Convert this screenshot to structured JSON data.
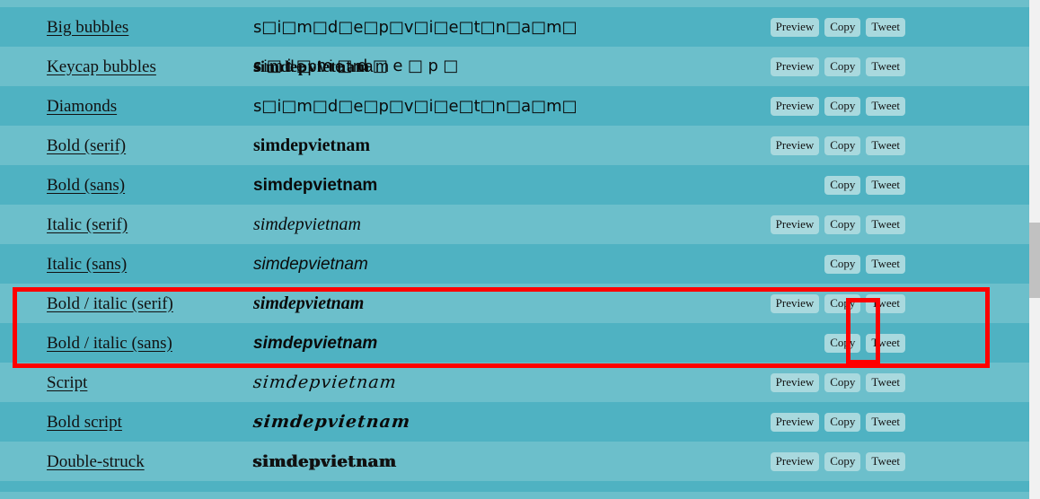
{
  "page": {
    "colors": {
      "row_light": "#6cbfcb",
      "row_dark": "#4fb2c2",
      "button_bg": "#a9d9de",
      "highlight": "#fe0000",
      "scrollbar_track": "#f1f1f1",
      "scrollbar_thumb": "#c1c1c1"
    }
  },
  "buttons": {
    "preview": "Preview",
    "copy": "Copy",
    "tweet": "Tweet"
  },
  "rows": [
    {
      "name": "Big bubbles",
      "sample": "s□i□m□d□e□p□v□i□e□t□n□a□m□",
      "has_preview": true
    },
    {
      "name": "Keycap bubbles",
      "sample": "simdepvietnam",
      "sample_overlay_a": "s□i□m□d□e□p□",
      "sample_overlay_b": "simdepvietnam",
      "sample_overlay_c": "simdepvietnam",
      "has_preview": true
    },
    {
      "name": "Diamonds",
      "sample": "s□i□m□d□e□p□v□i□e□t□n□a□m□",
      "has_preview": true
    },
    {
      "name": "Bold (serif)",
      "sample": "simdepvietnam",
      "has_preview": true
    },
    {
      "name": "Bold (sans)",
      "sample": "simdepvietnam",
      "has_preview": false
    },
    {
      "name": "Italic (serif)",
      "sample": "simdepvietnam",
      "has_preview": true
    },
    {
      "name": "Italic (sans)",
      "sample": "simdepvietnam",
      "has_preview": false
    },
    {
      "name": "Bold / italic (serif)",
      "sample": "simdepvietnam",
      "has_preview": true
    },
    {
      "name": "Bold / italic (sans)",
      "sample": "simdepvietnam",
      "has_preview": false
    },
    {
      "name": "Script",
      "sample": "simdepvietnam",
      "has_preview": true
    },
    {
      "name": "Bold script",
      "sample": "simdepvietnam",
      "has_preview": true
    },
    {
      "name": "Double-struck",
      "sample": "simdepvietnam",
      "has_preview": true
    }
  ]
}
